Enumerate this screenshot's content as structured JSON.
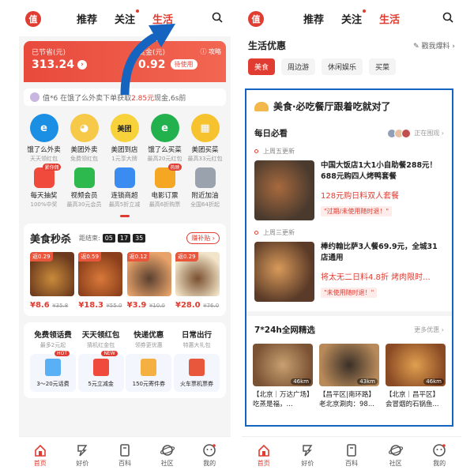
{
  "left": {
    "logo": "值",
    "tabs": [
      "推荐",
      "关注",
      "生活"
    ],
    "savings": {
      "saved_label": "已节省(元)",
      "saved_value": "313.24",
      "gold_label": "赏金(元)",
      "gold_value": "0.92",
      "withdraw_label": "待使用",
      "guide_label": "攻略"
    },
    "ticker": {
      "prefix": "值*6 在饿了么外卖下单获取",
      "amount": "2.85元",
      "suffix": "现金,6s前"
    },
    "services": [
      {
        "title": "饿了么外卖",
        "sub": "天天领红包",
        "glyph": "e",
        "color": "#1a8fe3"
      },
      {
        "title": "美团外卖",
        "sub": "免费领红包",
        "glyph": "◕",
        "color": "#f7c948"
      },
      {
        "title": "美团到店",
        "sub": "1元享大牌",
        "glyph": "美团",
        "color": "#f8d23a"
      },
      {
        "title": "饿了么买菜",
        "sub": "最高20元红包",
        "glyph": "e",
        "color": "#22b14c"
      },
      {
        "title": "美团买菜",
        "sub": "最高33元红包",
        "glyph": "▦",
        "color": "#f6c22e"
      }
    ],
    "services2": [
      {
        "title": "每天抽奖",
        "sub": "100%中奖",
        "tag": "紧你佣",
        "color": "#f04a3c"
      },
      {
        "title": "视频会员",
        "sub": "最高30元会员",
        "tag": "",
        "color": "#2db94d"
      },
      {
        "title": "连锁商超",
        "sub": "最高5折立减",
        "tag": "",
        "color": "#3b8cf0"
      },
      {
        "title": "电影订票",
        "sub": "最高6折购票",
        "tag": "热映",
        "color": "#f5a623"
      },
      {
        "title": "附近加油",
        "sub": "全国64折起",
        "tag": "",
        "color": "#9aa3ad"
      }
    ],
    "flash_sale": {
      "title": "美食秒杀",
      "countdown_label": "距结束:",
      "hours": "05",
      "minutes": "17",
      "seconds": "35",
      "more": "赚补贴",
      "items": [
        {
          "badge": "返0.29",
          "price": "¥8.6",
          "orig": "¥35.8",
          "c1": "#6b3a1e",
          "c2": "#c98b3a"
        },
        {
          "badge": "返0.59",
          "price": "¥18.3",
          "orig": "¥55.0",
          "c1": "#8a3e1a",
          "c2": "#d8793a"
        },
        {
          "badge": "返0.12",
          "price": "¥3.9",
          "orig": "¥10.0",
          "c1": "#e8a36a",
          "c2": "#5a4030"
        },
        {
          "badge": "返0.29",
          "price": "¥28.0",
          "orig": "¥76.0",
          "c1": "#f2e4c8",
          "c2": "#7a5030"
        }
      ]
    },
    "coupons": [
      {
        "title": "免费领话费",
        "sub": "最多2元起",
        "box": "3～20元话费",
        "hot": "HOT",
        "color": "#5ab0f5"
      },
      {
        "title": "天天领红包",
        "sub": "猜机红金包",
        "box": "5元立减金",
        "hot": "NEW",
        "color": "#f04a3c"
      },
      {
        "title": "快递优惠",
        "sub": "领券更优惠",
        "box": "150元寄件券",
        "hot": "",
        "color": "#f5b042"
      },
      {
        "title": "日常出行",
        "sub": "特惠大礼包",
        "box": "火车票机票券",
        "hot": "",
        "color": "#e8563c"
      }
    ],
    "nav": [
      "首页",
      "好价",
      "百科",
      "社区",
      "我的"
    ]
  },
  "right": {
    "logo": "值",
    "tabs": [
      "推荐",
      "关注",
      "生活"
    ],
    "section_title": "生活优惠",
    "section_link": "戳我爆料",
    "chips": [
      "美食",
      "周边游",
      "休闲娱乐",
      "买菜"
    ],
    "banner_title": "美食·必吃餐厅跟着吃就对了",
    "must_buy": "每日必看",
    "watching": "正在围观",
    "deals": [
      {
        "updated": "上周五更新",
        "title": "中国大饭店1大1小自助餐288元！688元购四人烤鸭套餐",
        "sub": "128元购日料双人套餐",
        "tag": "\"过期/未使用随时退！\"",
        "c1": "#4a3a2e",
        "c2": "#a86a3e"
      },
      {
        "updated": "上周三更新",
        "title": "棒约翰比萨3人餐69.9元，全城31店通用",
        "sub": "将太无二日料4.8折  烤肉限时...",
        "tag": "\"未使用随时退！\"",
        "c1": "#5a3a28",
        "c2": "#d89a5a"
      }
    ],
    "nationwide": "7*24h全网精选",
    "more_deals": "更多优惠",
    "picks": [
      {
        "km": "46km",
        "caption": "【北京｜万达广场】吃蒸是福，...",
        "c1": "#c8a070",
        "c2": "#7a5234"
      },
      {
        "km": "43km",
        "caption": "【昌平区|南环路】老北京涮肉：98...",
        "c1": "#3a3028",
        "c2": "#b88a5a"
      },
      {
        "km": "46km",
        "caption": "【北京｜昌平区】会冒烟的石锅鱼...",
        "c1": "#e0a050",
        "c2": "#8a4a24"
      }
    ],
    "nav": [
      "首页",
      "好价",
      "百科",
      "社区",
      "我的"
    ]
  }
}
